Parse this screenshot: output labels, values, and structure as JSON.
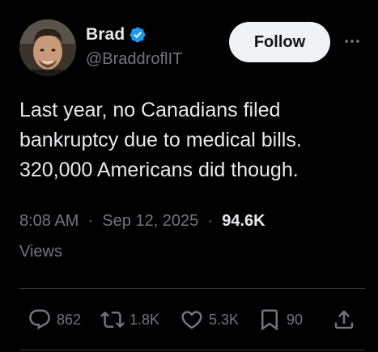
{
  "tweet": {
    "author": {
      "display_name": "Brad",
      "handle": "@BraddroflIT",
      "verified_icon": "verified-badge-icon",
      "verified_color": "#1d9bf0"
    },
    "follow_label": "Follow",
    "more_icon": "more-horizontal-icon",
    "text_lines": [
      "Last year, no Canadians filed",
      "bankruptcy due to medical bills.",
      "320,000 Americans did though."
    ],
    "time": "8:08 AM",
    "separator": "·",
    "date": "Sep 12, 2025",
    "views_count": "94.6K",
    "views_label": "Views",
    "actions": {
      "replies": {
        "icon": "reply-icon",
        "count": "862"
      },
      "reposts": {
        "icon": "repost-icon",
        "count": "1.8K"
      },
      "likes": {
        "icon": "heart-icon",
        "count": "5.3K"
      },
      "bookmarks": {
        "icon": "bookmark-icon",
        "count": "90"
      },
      "share": {
        "icon": "share-icon"
      }
    }
  },
  "colors": {
    "background": "#000000",
    "text_primary": "#e7e9ea",
    "text_secondary": "#71767b",
    "divider": "#2f3336",
    "follow_bg": "#eff3f4",
    "follow_text": "#0f1419"
  }
}
